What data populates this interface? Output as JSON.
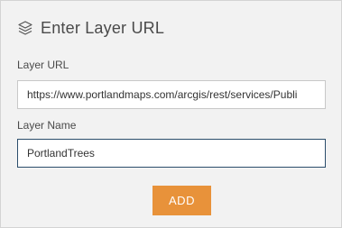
{
  "dialog": {
    "title": "Enter Layer URL",
    "icon": "layers-icon"
  },
  "layer_url": {
    "label": "Layer URL",
    "value": "https://www.portlandmaps.com/arcgis/rest/services/Publi"
  },
  "layer_name": {
    "label": "Layer Name",
    "value": "PortlandTrees"
  },
  "add_button": {
    "label": "ADD",
    "color": "#e8923a"
  }
}
